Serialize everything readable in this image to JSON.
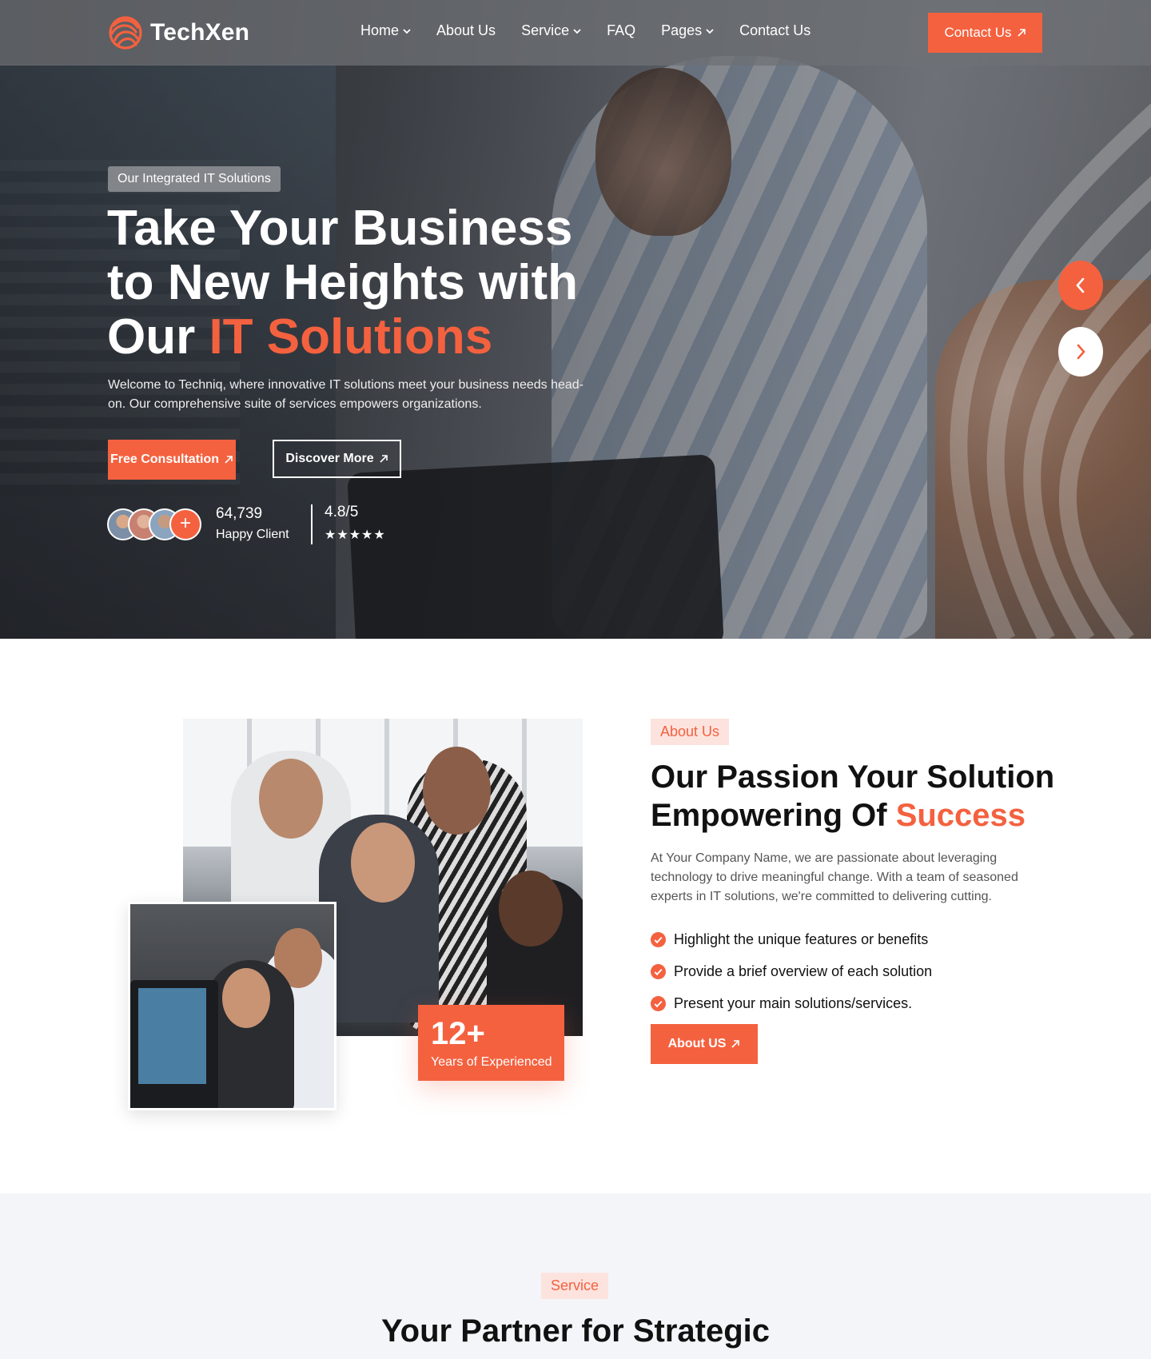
{
  "brand": {
    "name": "TechXen",
    "accent": "#f4613f"
  },
  "nav": {
    "items": [
      {
        "label": "Home",
        "dropdown": true
      },
      {
        "label": "About Us",
        "dropdown": false
      },
      {
        "label": "Service",
        "dropdown": true
      },
      {
        "label": "FAQ",
        "dropdown": false
      },
      {
        "label": "Pages",
        "dropdown": true
      },
      {
        "label": "Contact Us",
        "dropdown": false
      }
    ],
    "cta_label": "Contact Us"
  },
  "hero": {
    "badge": "Our Integrated IT Solutions",
    "title_part1": "Take Your Business to New Heights with Our ",
    "title_accent": "IT Solutions",
    "description": "Welcome to Techniq, where innovative IT solutions meet your business needs head-on. Our comprehensive suite of services empowers organizations.",
    "btn_primary": "Free Consultation",
    "btn_secondary": "Discover More",
    "client_count": "64,739",
    "client_label": "Happy Client",
    "rating": "4.8/5",
    "stars": "★★★★★",
    "rating_value": 5,
    "avatar_plus": "+"
  },
  "about": {
    "badge": "About Us",
    "title_part1": "Our Passion Your Solution Empowering Of ",
    "title_accent": "Success",
    "description": "At Your Company Name, we are passionate about leveraging technology to drive meaningful change. With a team of seasoned experts in IT solutions, we're committed to delivering cutting.",
    "checklist": [
      "Highlight the unique features or benefits",
      "Provide a brief overview of each solution",
      "Present your main solutions/services."
    ],
    "button": "About US",
    "experience_number": "12+",
    "experience_label": "Years of Experienced"
  },
  "service": {
    "badge": "Service",
    "title": "Your Partner for Strategic"
  },
  "icons": {
    "arrow": "arrow-up-right-icon",
    "check": "check-circle-icon",
    "chevron": "chevron-down-icon",
    "prev": "chevron-left-icon",
    "next": "chevron-right-icon"
  }
}
